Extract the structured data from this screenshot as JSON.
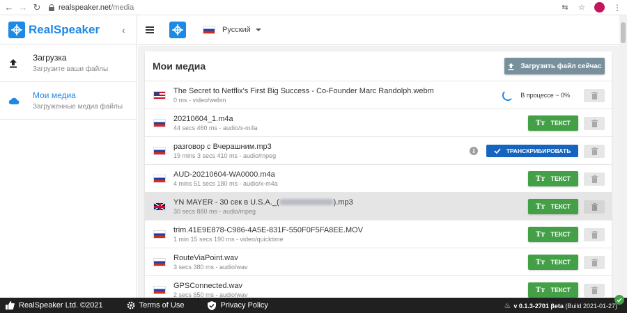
{
  "browser": {
    "url_host": "realspeaker.net",
    "url_path": "/media"
  },
  "sidebar": {
    "brand": "RealSpeaker",
    "items": [
      {
        "title": "Загрузка",
        "subtitle": "Загрузите ваши файлы",
        "icon": "upload-icon",
        "active": false
      },
      {
        "title": "Мои медиа",
        "subtitle": "Загруженные медиа файлы",
        "icon": "cloud-icon",
        "active": true
      }
    ]
  },
  "topbar": {
    "language": "Русский"
  },
  "main": {
    "title": "Мои медиа",
    "upload_button": "Загрузить файл сейчас",
    "rows": [
      {
        "flag": "us",
        "name": "The Secret to Netflix's First Big Success - Co-Founder Marc Randolph.webm",
        "duration": "0 ms",
        "mime": "video/webm",
        "status": "В процессе ~ 0%"
      },
      {
        "flag": "ru",
        "name": "20210604_1.m4a",
        "duration": "44 secs 460 ms",
        "mime": "audio/x-m4a",
        "action": "ТЕКСТ"
      },
      {
        "flag": "ru",
        "name": "разговор с Вчерашним.mp3",
        "duration": "19 mins 3 secs 410 ms",
        "mime": "audio/mpeg",
        "action": "ТРАНСКРИБИРОВАТЬ"
      },
      {
        "flag": "ru",
        "name": "AUD-20210604-WA0000.m4a",
        "duration": "4 mins 51 secs 180 ms",
        "mime": "audio/x-m4a",
        "action": "ТЕКСТ"
      },
      {
        "flag": "uk",
        "name_prefix": "YN MAYER - 30 сек в U.S.A._(",
        "name_suffix": ").mp3",
        "duration": "30 secs 880 ms",
        "mime": "audio/mpeg",
        "action": "ТЕКСТ",
        "highlighted": true
      },
      {
        "flag": "ru",
        "name": "trim.41E9E878-C986-4A5E-831F-550F0F5FA8EE.MOV",
        "duration": "1 min 15 secs 190 ms",
        "mime": "video/quicktime",
        "action": "ТЕКСТ"
      },
      {
        "flag": "ru",
        "name": "RouteViaPoint.wav",
        "duration": "3 secs 380 ms",
        "mime": "audio/wav",
        "action": "ТЕКСТ"
      },
      {
        "flag": "ru",
        "name": "GPSConnected.wav",
        "duration": "2 secs 650 ms",
        "mime": "audio/wav",
        "action": "ТЕКСТ"
      }
    ]
  },
  "footer": {
    "copyright": "RealSpeaker Ltd. ©2021",
    "terms": "Terms of Use",
    "privacy": "Privacy Policy",
    "version": "v 0.1.3-2701",
    "version_tag": "βeta",
    "build": "(Build 2021-01-27)"
  },
  "colors": {
    "brand": "#1e88e5",
    "text_button": "#43a047",
    "transcribe_button": "#1565c0",
    "upload_button": "#78909c",
    "footer": "#202020"
  }
}
